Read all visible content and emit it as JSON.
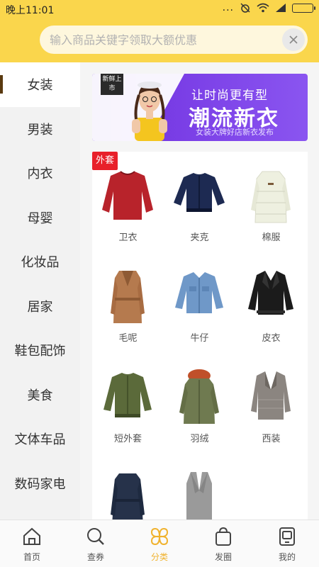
{
  "status": {
    "time": "晚上11:01",
    "dots": "...",
    "battery_level": 1.0
  },
  "search": {
    "placeholder": "输入商品关键字领取大额优惠",
    "value": ""
  },
  "sidebar": {
    "items": [
      {
        "label": "女装",
        "active": true
      },
      {
        "label": "男装",
        "active": false
      },
      {
        "label": "内衣",
        "active": false
      },
      {
        "label": "母婴",
        "active": false
      },
      {
        "label": "化妆品",
        "active": false
      },
      {
        "label": "居家",
        "active": false
      },
      {
        "label": "鞋包配饰",
        "active": false
      },
      {
        "label": "美食",
        "active": false
      },
      {
        "label": "文体车品",
        "active": false
      },
      {
        "label": "数码家电",
        "active": false
      }
    ]
  },
  "banner": {
    "tag": "新鲜上市",
    "headline": "让时尚更有型",
    "title": "潮流新衣",
    "subtitle": "女装大牌好店新衣发布"
  },
  "category_tag": "外套",
  "products": [
    {
      "label": "卫衣",
      "icon": "red-sweater",
      "color": "#b8232b"
    },
    {
      "label": "夹克",
      "icon": "navy-bomber",
      "color": "#1d2a52"
    },
    {
      "label": "棉服",
      "icon": "white-puffer",
      "color": "#eef0e0"
    },
    {
      "label": "毛呢",
      "icon": "camel-coat",
      "color": "#b57a4e"
    },
    {
      "label": "牛仔",
      "icon": "denim-jacket",
      "color": "#6f98c8"
    },
    {
      "label": "皮衣",
      "icon": "leather-jacket",
      "color": "#1b1b1b"
    },
    {
      "label": "短外套",
      "icon": "green-bomber",
      "color": "#5b6a3a"
    },
    {
      "label": "羽绒",
      "icon": "green-parka",
      "color": "#6f7a50"
    },
    {
      "label": "西装",
      "icon": "plaid-blazer",
      "color": "#8b8580"
    },
    {
      "label": "",
      "icon": "navy-trench",
      "color": "#26324a"
    },
    {
      "label": "",
      "icon": "grey-vest",
      "color": "#9a9a9a"
    }
  ],
  "tabs": [
    {
      "label": "首页",
      "icon": "home-icon",
      "active": false
    },
    {
      "label": "查券",
      "icon": "search-coupon-icon",
      "active": false
    },
    {
      "label": "分类",
      "icon": "category-icon",
      "active": true
    },
    {
      "label": "发圈",
      "icon": "bag-icon",
      "active": false
    },
    {
      "label": "我的",
      "icon": "profile-icon",
      "active": false
    }
  ],
  "colors": {
    "accent": "#fad64c",
    "active_tab": "#f0b22d",
    "tag_red": "#e8202a",
    "banner_purple": "#7a3ee6"
  }
}
